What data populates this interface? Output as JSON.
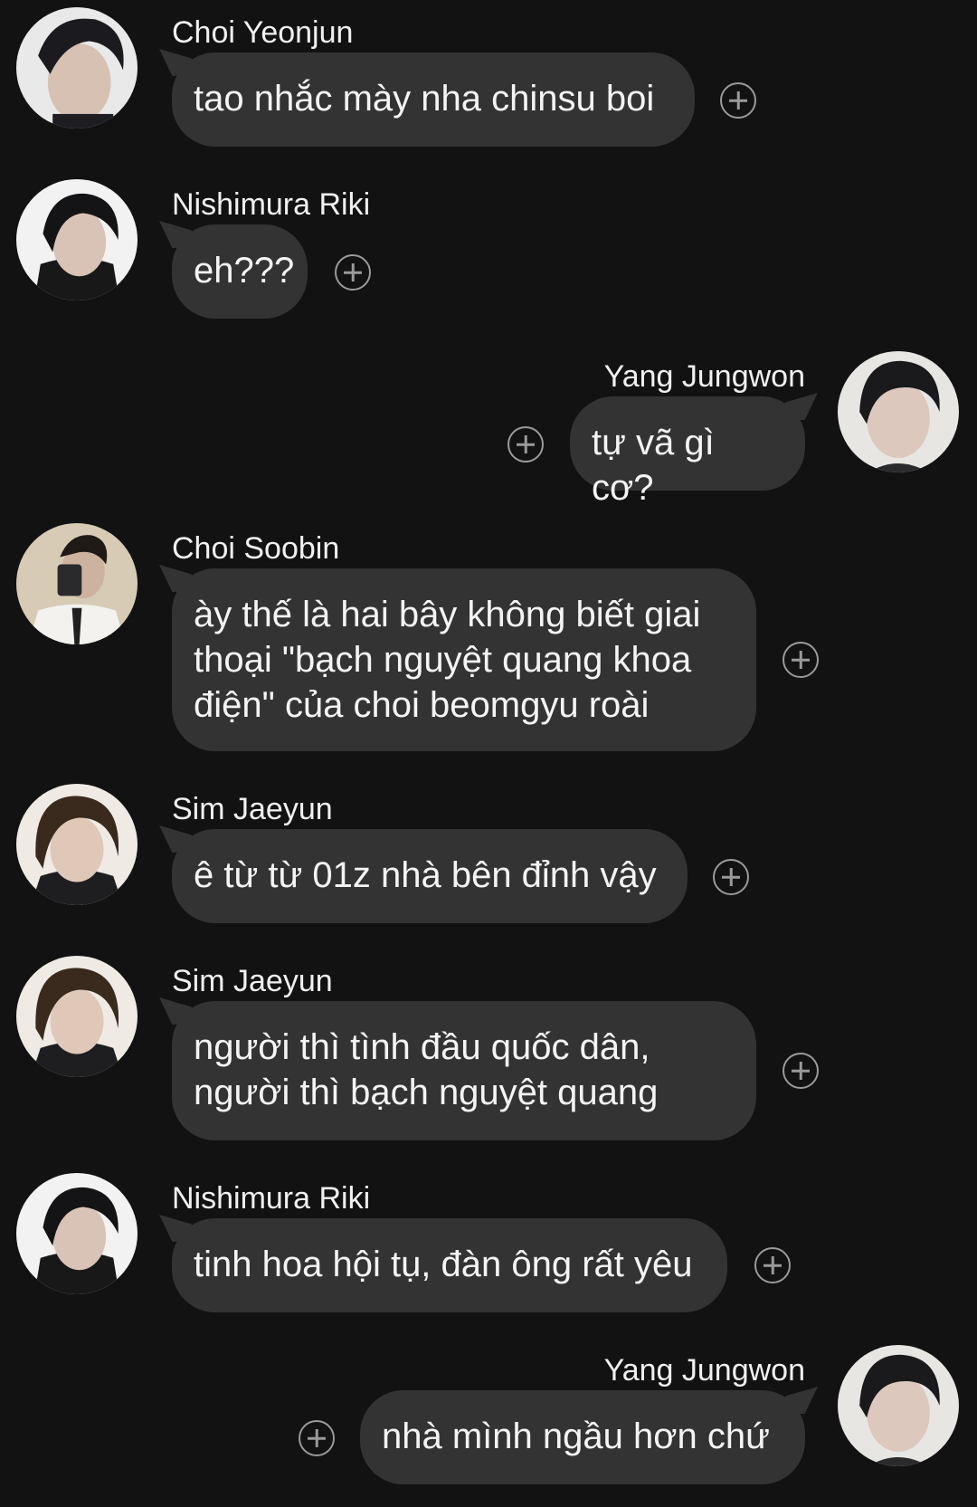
{
  "messages": [
    {
      "sender": "Choi Yeonjun",
      "text": "tao nhắc mày nha chinsu boi",
      "side": "in",
      "avatar_icon": "yeonjun-avatar"
    },
    {
      "sender": "Nishimura Riki",
      "text": "eh???",
      "side": "in",
      "avatar_icon": "riki-avatar"
    },
    {
      "sender": "Yang Jungwon",
      "text": "tự vã gì cơ?",
      "side": "out",
      "avatar_icon": "jungwon-avatar"
    },
    {
      "sender": "Choi Soobin",
      "text": "ày thế là hai bây không biết giai\nthoại \"bạch nguyệt quang khoa\nđiện\" của choi beomgyu roài",
      "side": "in",
      "avatar_icon": "soobin-avatar"
    },
    {
      "sender": "Sim Jaeyun",
      "text": "ê từ từ 01z nhà bên đỉnh vậy",
      "side": "in",
      "avatar_icon": "jaeyun-avatar"
    },
    {
      "sender": "Sim Jaeyun",
      "text": "người thì tình đầu quốc dân,\nngười thì bạch nguyệt quang",
      "side": "in",
      "avatar_icon": "jaeyun-avatar"
    },
    {
      "sender": "Nishimura Riki",
      "text": "tinh hoa hội tụ, đàn ông rất yêu",
      "side": "in",
      "avatar_icon": "riki-avatar"
    },
    {
      "sender": "Yang Jungwon",
      "text": "nhà mình ngầu hơn chứ",
      "side": "out",
      "avatar_icon": "jungwon-avatar"
    }
  ],
  "colors": {
    "background": "#121212",
    "bubble": "#333333",
    "text": "#f4f4f4",
    "react_icon": "#9a9a9a"
  }
}
